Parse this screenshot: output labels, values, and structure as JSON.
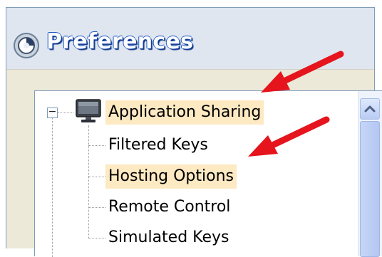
{
  "window": {
    "title": "Preferences"
  },
  "tree": {
    "root": {
      "label": "Application Sharing",
      "expander": "−",
      "icon": "monitor-icon"
    },
    "children": [
      {
        "label": "Filtered Keys"
      },
      {
        "label": "Hosting Options"
      },
      {
        "label": "Remote Control"
      },
      {
        "label": "Simulated Keys"
      }
    ]
  },
  "highlights": [
    "Application Sharing",
    "Hosting Options"
  ],
  "colors": {
    "selection": "#fde9c2",
    "annotation_arrow": "#e5141d",
    "title_text": "#ffffff",
    "title_outline": "#1c56c6"
  }
}
